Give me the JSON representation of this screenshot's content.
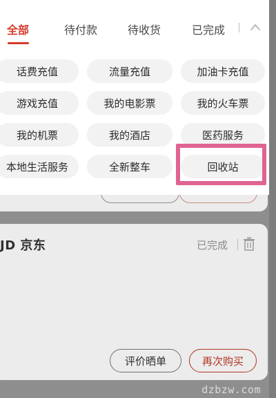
{
  "tabs": [
    {
      "label": "全部",
      "active": true
    },
    {
      "label": "待付款",
      "active": false
    },
    {
      "label": "待收货",
      "active": false
    },
    {
      "label": "已完成",
      "active": false
    }
  ],
  "services": [
    {
      "label": "话费充值"
    },
    {
      "label": "流量充值"
    },
    {
      "label": "加油卡充值"
    },
    {
      "label": "游戏充值"
    },
    {
      "label": "我的电影票"
    },
    {
      "label": "我的火车票"
    },
    {
      "label": "我的机票"
    },
    {
      "label": "我的酒店"
    },
    {
      "label": "医药服务"
    },
    {
      "label": "本地生活服务"
    },
    {
      "label": "全新整车"
    },
    {
      "label": "回收站"
    }
  ],
  "order": {
    "shop_name": "JD 京东",
    "status": "已完成",
    "review_button": "评价晒单",
    "rebuy_button": "再次购买"
  },
  "watermark": "dzbzw.com",
  "colors": {
    "accent": "#d43a2a",
    "highlight": "#e06492"
  },
  "icons": {
    "collapse": "chevron-up-icon",
    "trash": "trash-icon"
  }
}
